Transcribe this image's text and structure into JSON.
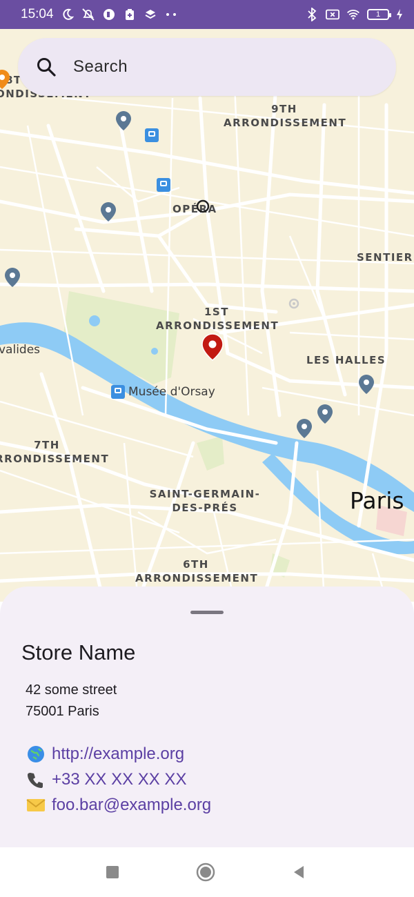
{
  "status_bar": {
    "time": "15:04",
    "battery_level": "1",
    "left_icons": [
      "moon-icon",
      "mute-icon",
      "app-icon",
      "clipboard-icon",
      "layers-icon",
      "more-dots-icon"
    ],
    "right_icons": [
      "bluetooth-icon",
      "no-sim-icon",
      "wifi-icon",
      "battery-icon",
      "charging-icon"
    ]
  },
  "search": {
    "placeholder": "Search"
  },
  "map": {
    "labels": {
      "arr9": "9TH\nARRONDISSEMENT",
      "opera": "OPÉRA",
      "sentier": "SENTIER",
      "arr1": "1ST\nARRONDISSEMENT",
      "les_halles": "LES HALLES",
      "arr7": "7TH\nARRONDISSEMENT",
      "saint_germain": "SAINT-GERMAIN-\nDES-PRÉS",
      "arr6": "6TH\nARRONDISSEMENT",
      "arr8_partial": "8T\nONDISSEMENT",
      "invalides_partial": "valides",
      "musee_orsay": "Musée d'Orsay",
      "paris": "Paris"
    },
    "colors": {
      "land": "#f7f1dc",
      "water": "#8ecbf5",
      "park": "#e4edc8",
      "road": "#ffffff",
      "pin": "#5b7894",
      "selected_pin": "#c21a12"
    }
  },
  "store": {
    "name": "Store Name",
    "address_line1": "42 some street",
    "address_line2": "75001 Paris",
    "website": "http://example.org",
    "phone": "+33 XX XX XX XX",
    "email": "foo.bar@example.org"
  },
  "nav": {
    "buttons": [
      "recents-button",
      "home-button",
      "back-button"
    ]
  }
}
